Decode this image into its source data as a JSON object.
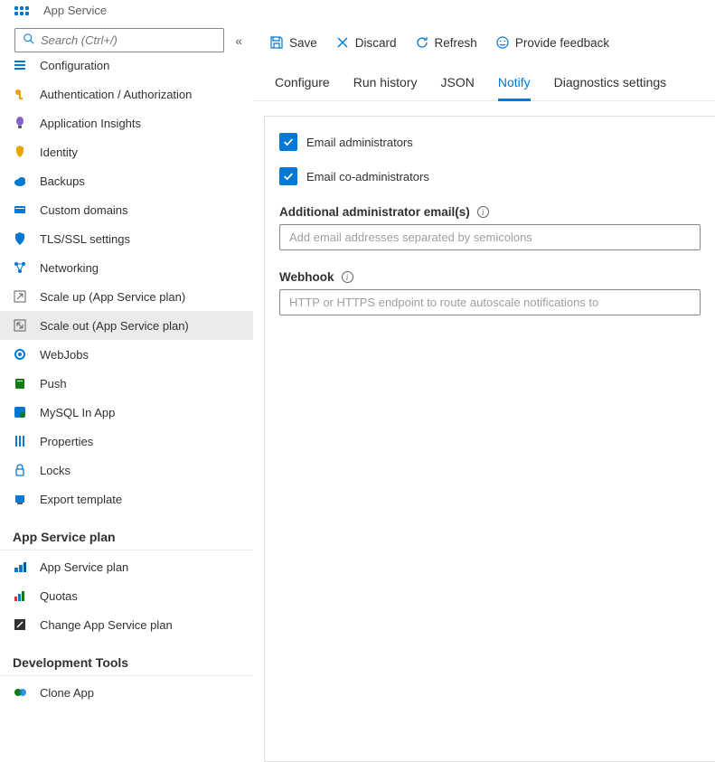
{
  "header": {
    "title": "App Service"
  },
  "search": {
    "placeholder": "Search (Ctrl+/)"
  },
  "sidebar": {
    "items": [
      {
        "label": "Configuration",
        "icon": "config",
        "truncated": true
      },
      {
        "label": "Authentication / Authorization",
        "icon": "key"
      },
      {
        "label": "Application Insights",
        "icon": "bulb"
      },
      {
        "label": "Identity",
        "icon": "identity"
      },
      {
        "label": "Backups",
        "icon": "cloud"
      },
      {
        "label": "Custom domains",
        "icon": "domain"
      },
      {
        "label": "TLS/SSL settings",
        "icon": "shield"
      },
      {
        "label": "Networking",
        "icon": "network"
      },
      {
        "label": "Scale up (App Service plan)",
        "icon": "scaleup"
      },
      {
        "label": "Scale out (App Service plan)",
        "icon": "scaleout",
        "active": true
      },
      {
        "label": "WebJobs",
        "icon": "webjobs"
      },
      {
        "label": "Push",
        "icon": "push"
      },
      {
        "label": "MySQL In App",
        "icon": "mysql"
      },
      {
        "label": "Properties",
        "icon": "props"
      },
      {
        "label": "Locks",
        "icon": "lock"
      },
      {
        "label": "Export template",
        "icon": "export"
      }
    ],
    "section1": "App Service plan",
    "section1_items": [
      {
        "label": "App Service plan",
        "icon": "plan"
      },
      {
        "label": "Quotas",
        "icon": "quotas"
      },
      {
        "label": "Change App Service plan",
        "icon": "changeplan"
      }
    ],
    "section2": "Development Tools",
    "section2_items": [
      {
        "label": "Clone App",
        "icon": "clone"
      }
    ]
  },
  "toolbar": {
    "save": "Save",
    "discard": "Discard",
    "refresh": "Refresh",
    "feedback": "Provide feedback"
  },
  "tabs": {
    "items": [
      {
        "label": "Configure"
      },
      {
        "label": "Run history"
      },
      {
        "label": "JSON"
      },
      {
        "label": "Notify",
        "active": true
      },
      {
        "label": "Diagnostics settings"
      }
    ]
  },
  "form": {
    "email_admins": "Email administrators",
    "email_coadmins": "Email co-administrators",
    "additional_label": "Additional administrator email(s)",
    "additional_placeholder": "Add email addresses separated by semicolons",
    "webhook_label": "Webhook",
    "webhook_placeholder": "HTTP or HTTPS endpoint to route autoscale notifications to"
  }
}
